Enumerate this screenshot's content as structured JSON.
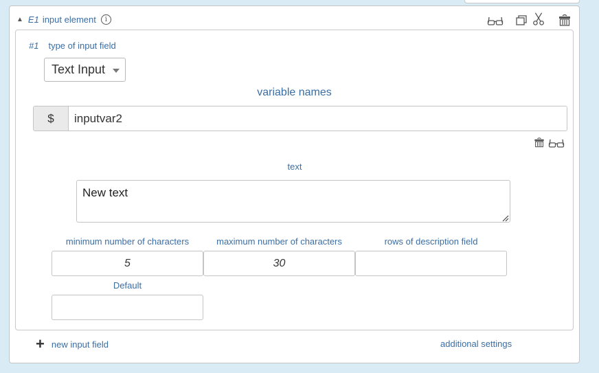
{
  "element": {
    "id": "E1",
    "title": "input element",
    "toolbar_icons": [
      "glasses-icon",
      "copy-icon",
      "scissors-icon",
      "trash-icon"
    ]
  },
  "field": {
    "number": "#1",
    "type_label": "type of input field",
    "type_value": "Text Input",
    "variable_names_label": "variable names",
    "variable_prefix": "$",
    "variable_value": "inputvar2",
    "text_label": "text",
    "text_value": "New text",
    "min_label": "minimum number of characters",
    "min_value": "5",
    "max_label": "maximum number of characters",
    "max_value": "30",
    "rows_label": "rows of description field",
    "rows_value": "",
    "default_label": "Default",
    "default_value": ""
  },
  "footer": {
    "add_label": "new input field",
    "settings_label": "additional settings"
  }
}
